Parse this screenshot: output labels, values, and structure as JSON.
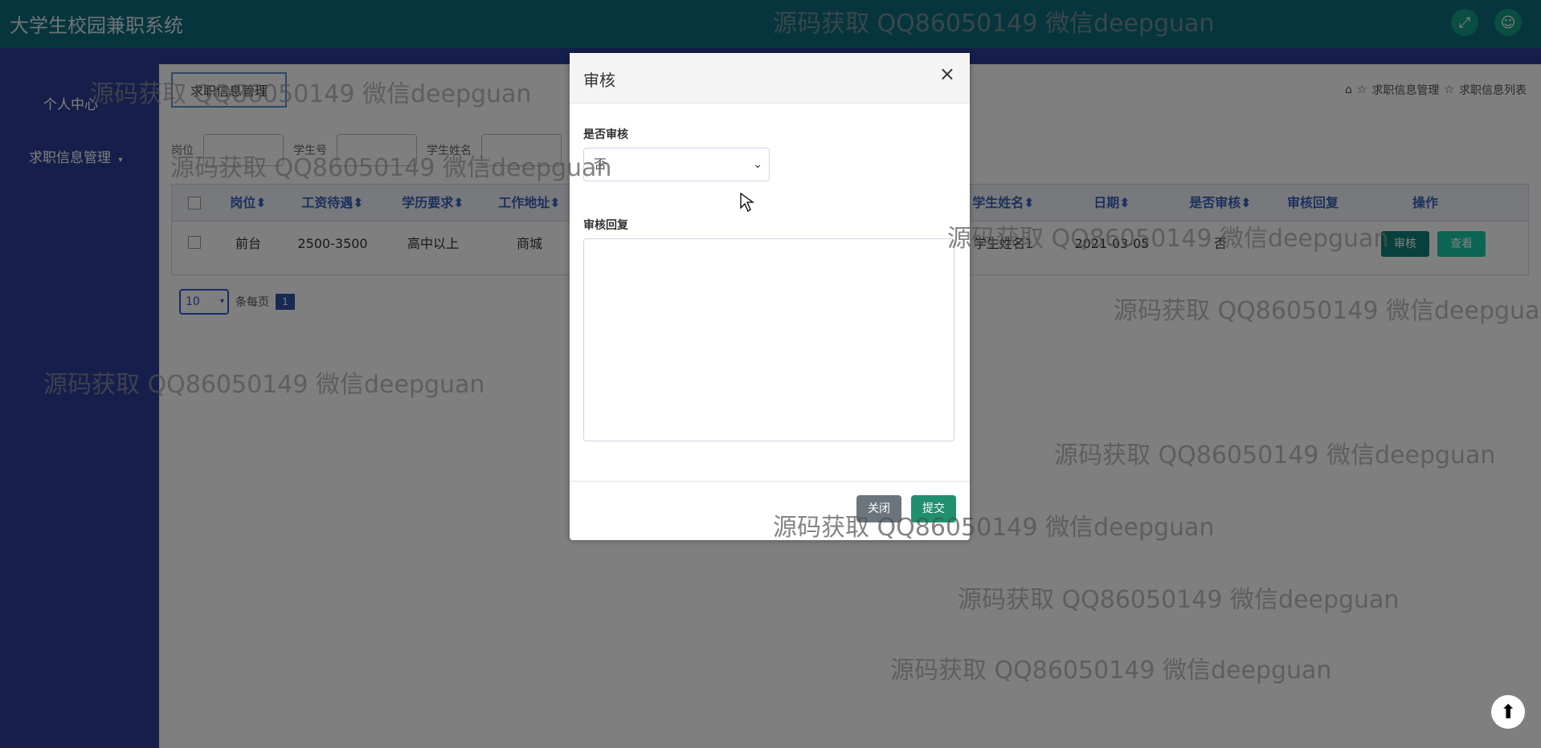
{
  "app": {
    "title": "大学生校园兼职系统",
    "icons": [
      "fullscreen-icon",
      "user-icon"
    ]
  },
  "sidebar": {
    "items": [
      {
        "label": "个人中心"
      },
      {
        "label": "求职信息管理"
      }
    ]
  },
  "page": {
    "tab_label": "求职信息管理",
    "breadcrumbs": [
      "求职信息管理",
      "求职信息列表"
    ],
    "search_labels": [
      "岗位",
      "学生号",
      "学生姓名"
    ]
  },
  "table": {
    "headers": [
      "岗位",
      "工资待遇",
      "学历要求",
      "工作地址",
      "学生姓名",
      "日期",
      "是否审核",
      "审核回复",
      "操作"
    ],
    "row": {
      "post": "前台",
      "salary": "2500-3500",
      "education": "高中以上",
      "address": "商城",
      "student_name": "学生姓名1",
      "date": "2021-03-05",
      "audit": "否",
      "reply": "",
      "action_audit": "审核",
      "action_view": "查看"
    }
  },
  "pager": {
    "page_size": "10",
    "per_page_label": "条每页",
    "current_page": "1"
  },
  "modal": {
    "title": "审核",
    "close_symbol": "×",
    "audit_label": "是否审核",
    "audit_value": "否",
    "reply_label": "审核回复",
    "reply_value": "",
    "close_button": "关闭",
    "submit_button": "提交"
  },
  "watermark": "源码获取 QQ86050149 微信deepguan",
  "colors": {
    "topbar": "#0d6b7c",
    "sidebar": "#2d3e96",
    "audit_button": "#11807a",
    "view_button": "#19c9a4",
    "submit_button": "#1f8f6f",
    "close_button": "#6c757d"
  }
}
